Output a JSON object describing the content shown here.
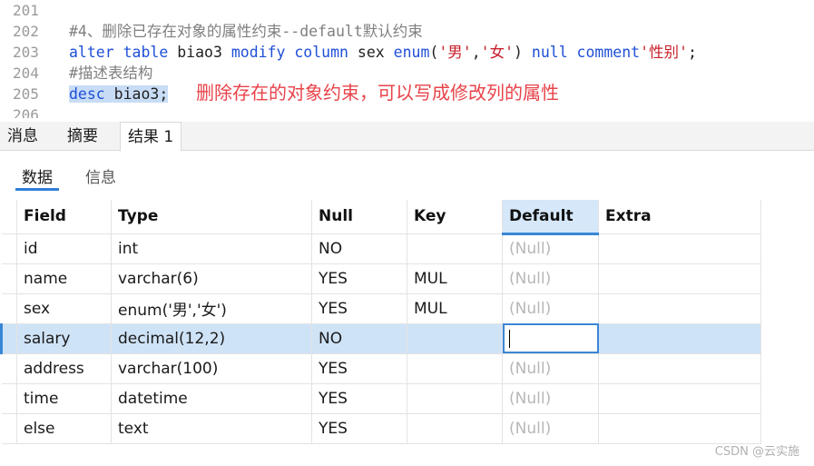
{
  "editor": {
    "lines": [
      {
        "number": "201"
      },
      {
        "number": "202",
        "comment": "#4、删除已存在对象的属性约束--default默认约束"
      },
      {
        "number": "203",
        "kw1": "alter table",
        "t1": " biao3 ",
        "kw2": "modify column",
        "t2": " sex ",
        "kw3": "enum",
        "t3": "(",
        "s1": "'男'",
        "t4": ",",
        "s2": "'女'",
        "t5": ") ",
        "kw4": "null comment",
        "s3": "'性别'",
        "t6": ";"
      },
      {
        "number": "204",
        "comment": "#描述表结构"
      },
      {
        "number": "205",
        "kw1": "desc",
        "t1": " biao3;"
      },
      {
        "number": "206"
      }
    ],
    "annotation": "删除存在的对象约束，可以写成修改列的属性"
  },
  "tabs": [
    "消息",
    "摘要",
    "结果 1"
  ],
  "active_tab": "结果 1",
  "subtabs": [
    "数据",
    "信息"
  ],
  "grid": {
    "columns": [
      "Field",
      "Type",
      "Null",
      "Key",
      "Default",
      "Extra"
    ],
    "sorted_column": "Default",
    "rows": [
      {
        "field": "id",
        "type": "int",
        "null": "NO",
        "key": "",
        "default": "(Null)",
        "extra": ""
      },
      {
        "field": "name",
        "type": "varchar(6)",
        "null": "YES",
        "key": "MUL",
        "default": "(Null)",
        "extra": ""
      },
      {
        "field": "sex",
        "type": "enum('男','女')",
        "null": "YES",
        "key": "MUL",
        "default": "(Null)",
        "extra": ""
      },
      {
        "field": "salary",
        "type": "decimal(12,2)",
        "null": "NO",
        "key": "",
        "default": "",
        "extra": ""
      },
      {
        "field": "address",
        "type": "varchar(100)",
        "null": "YES",
        "key": "",
        "default": "(Null)",
        "extra": ""
      },
      {
        "field": "time",
        "type": "datetime",
        "null": "YES",
        "key": "",
        "default": "(Null)",
        "extra": ""
      },
      {
        "field": "else",
        "type": "text",
        "null": "YES",
        "key": "",
        "default": "(Null)",
        "extra": ""
      }
    ],
    "selected_row": "salary"
  },
  "watermark": "CSDN @云实施",
  "colors": {
    "keyword": "#1f4fd8",
    "string": "#c8202b",
    "comment": "#7f7f7f",
    "annotation": "#e8434a",
    "selection": "#cfe3f7",
    "accent": "#3a86d6"
  }
}
